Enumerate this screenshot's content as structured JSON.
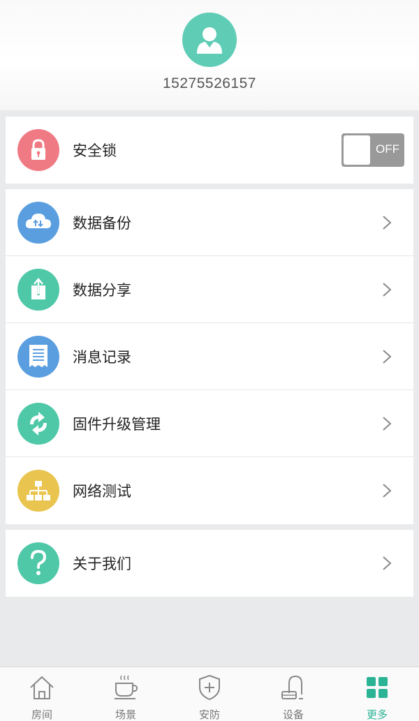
{
  "profile": {
    "phone": "15275526157"
  },
  "lock": {
    "label": "安全锁",
    "toggle_text": "OFF"
  },
  "menu": [
    {
      "label": "数据备份",
      "icon": "cloud-sync-icon",
      "color": "#5b9ee0"
    },
    {
      "label": "数据分享",
      "icon": "share-icon",
      "color": "#4fc8a8"
    },
    {
      "label": "消息记录",
      "icon": "message-log-icon",
      "color": "#5b9ee0"
    },
    {
      "label": "固件升级管理",
      "icon": "refresh-icon",
      "color": "#4fc8a8"
    },
    {
      "label": "网络测试",
      "icon": "network-icon",
      "color": "#e9c44e"
    }
  ],
  "about": {
    "label": "关于我们",
    "icon": "question-icon",
    "color": "#4fc8a8"
  },
  "tabs": [
    {
      "label": "房间",
      "icon": "home-icon"
    },
    {
      "label": "场景",
      "icon": "coffee-icon"
    },
    {
      "label": "安防",
      "icon": "shield-icon"
    },
    {
      "label": "设备",
      "icon": "vacuum-icon"
    },
    {
      "label": "更多",
      "icon": "grid-icon",
      "active": true
    }
  ],
  "colors": {
    "accent": "#2bb396",
    "lock_red": "#f07a84",
    "toggle_off": "#999999"
  }
}
